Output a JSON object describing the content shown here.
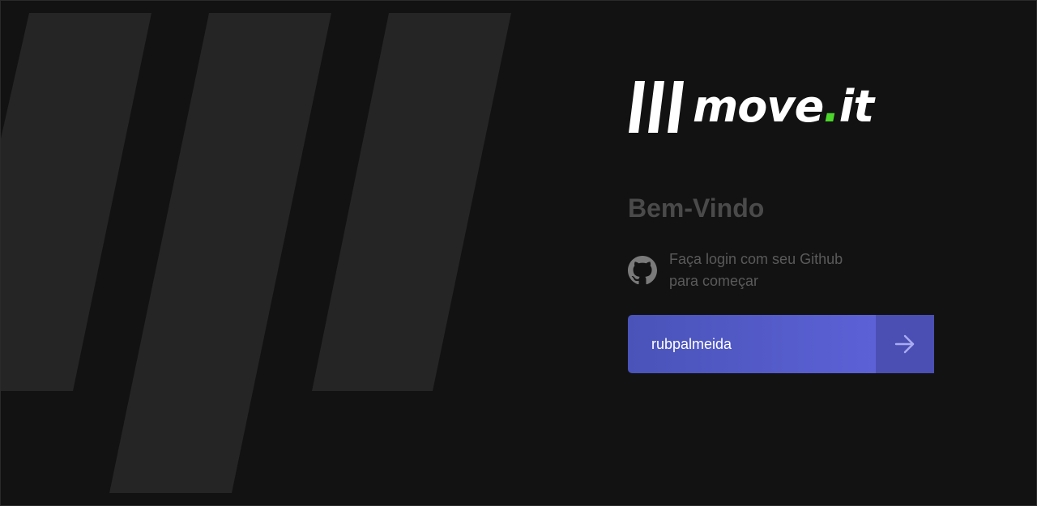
{
  "app": {
    "logo_text": "move",
    "logo_dot": ".",
    "logo_suffix": "it"
  },
  "login": {
    "welcome_title": "Bem-Vindo",
    "github_line1": "Faça login com seu Github",
    "github_line2": "para começar",
    "username_value": "rubpalmeida",
    "submit_icon": "arrow-right-icon"
  },
  "colors": {
    "background": "#121212",
    "stripe": "#252525",
    "accent": "#5965e0",
    "logo_dot": "#4cd62b",
    "muted_text": "#5a5a5a"
  }
}
